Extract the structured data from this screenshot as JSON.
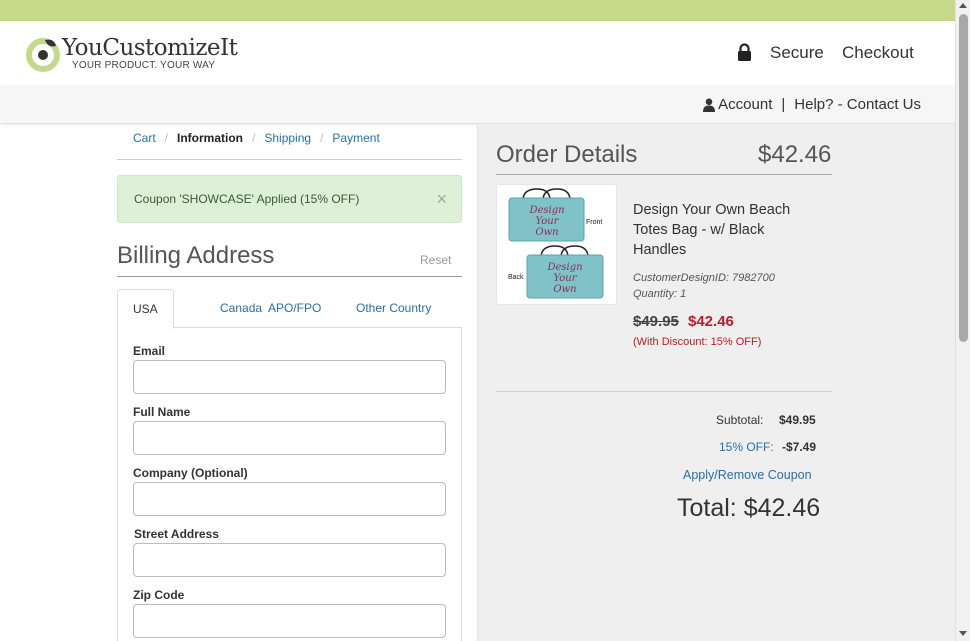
{
  "brand": {
    "name": "YouCustomizeIt",
    "tagline": "YOUR PRODUCT. YOUR WAY",
    "accent_color": "#c6d98a"
  },
  "header": {
    "secure_label": "Secure",
    "checkout_label": "Checkout",
    "lock_icon": "lock-icon"
  },
  "subheader": {
    "account_label": "Account",
    "separator": "|",
    "help_label": "Help? - Contact Us",
    "user_icon": "user-icon"
  },
  "breadcrumb": {
    "items": [
      {
        "label": "Cart"
      },
      {
        "label": "Information"
      },
      {
        "label": "Shipping"
      },
      {
        "label": "Payment"
      }
    ],
    "separator": "/",
    "current": "Information"
  },
  "coupon_alert": {
    "message": "Coupon 'SHOWCASE' Applied (15% OFF)",
    "close": "×"
  },
  "billing": {
    "title": "Billing Address",
    "reset_label": "Reset",
    "tabs": [
      {
        "label": "USA",
        "active": true
      },
      {
        "label": "Canada"
      },
      {
        "label": "APO/FPO"
      },
      {
        "label": "Other Country"
      }
    ],
    "fields": [
      {
        "label": "Email",
        "value": ""
      },
      {
        "label": "Full Name",
        "value": ""
      },
      {
        "label": "Company (Optional)",
        "value": ""
      },
      {
        "label": "Street Address",
        "value": ""
      },
      {
        "label": "Zip Code",
        "value": ""
      }
    ]
  },
  "order": {
    "title": "Order Details",
    "total_header": "$42.46",
    "item": {
      "name": "Design Your Own Beach Totes Bag - w/ Black Handles",
      "design_id": "CustomerDesignID: 7982700",
      "quantity": "Quantity: 1",
      "price_old": "$49.95",
      "price_new": "$42.46",
      "discount_note": "(With Discount: 15% OFF)",
      "thumb": {
        "front_label": "Front",
        "back_label": "Back",
        "bag_text": [
          "Design",
          "Your",
          "Own"
        ],
        "bag_color": "#7fc3c8"
      }
    },
    "summary": {
      "subtotal_label": "Subtotal:",
      "subtotal_value": "$49.95",
      "discount_label": "15% OFF:",
      "discount_value": "-$7.49",
      "apply_coupon_label": "Apply/Remove Coupon",
      "grand_total": "Total: $42.46"
    }
  },
  "colors": {
    "link": "#2a6fa8",
    "sale_red": "#c0192a",
    "alert_green_bg": "#dff0d8",
    "right_panel_bg": "#efefef"
  }
}
